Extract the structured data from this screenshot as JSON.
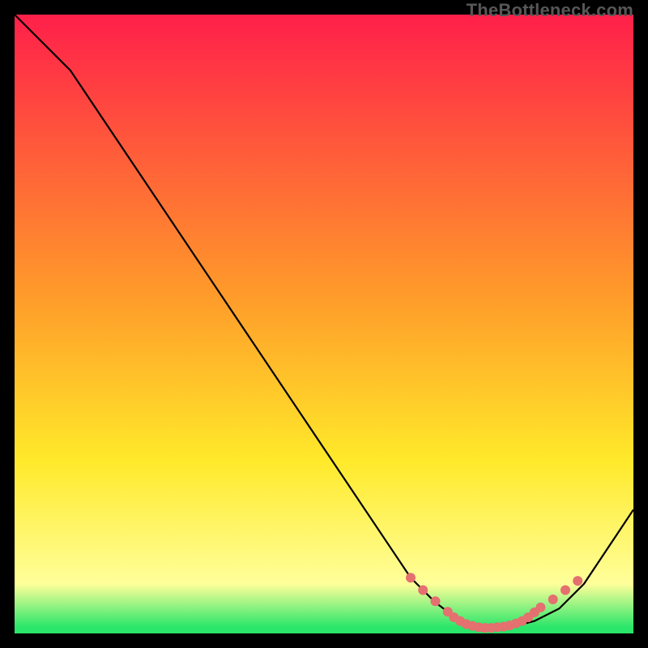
{
  "watermark": "TheBottleneck.com",
  "gradient": {
    "top": "#ff1f4a",
    "mid1": "#ff9a2a",
    "mid2": "#ffe92a",
    "low": "#ffff9a",
    "base": "#2ae66a"
  },
  "chart_data": {
    "type": "line",
    "title": "",
    "xlabel": "",
    "ylabel": "",
    "xlim": [
      0,
      100
    ],
    "ylim": [
      0,
      100
    ],
    "series": [
      {
        "name": "bottleneck-curve",
        "x": [
          0,
          9,
          64,
          68,
          72,
          76,
          80,
          84,
          88,
          92,
          100
        ],
        "values": [
          100,
          91,
          9,
          5,
          2,
          1,
          1,
          2,
          4,
          8,
          20
        ]
      }
    ],
    "dots": {
      "name": "highlight-dots",
      "x": [
        64,
        66,
        68,
        70,
        71,
        72,
        73,
        74,
        75,
        76,
        77,
        78,
        79,
        80,
        81,
        82,
        83,
        84,
        85,
        87,
        89,
        91
      ],
      "values": [
        9,
        7,
        5.2,
        3.5,
        2.6,
        2.0,
        1.5,
        1.2,
        1.0,
        0.9,
        0.9,
        1.0,
        1.1,
        1.3,
        1.6,
        2.0,
        2.6,
        3.4,
        4.2,
        5.5,
        7.0,
        8.5
      ]
    }
  }
}
